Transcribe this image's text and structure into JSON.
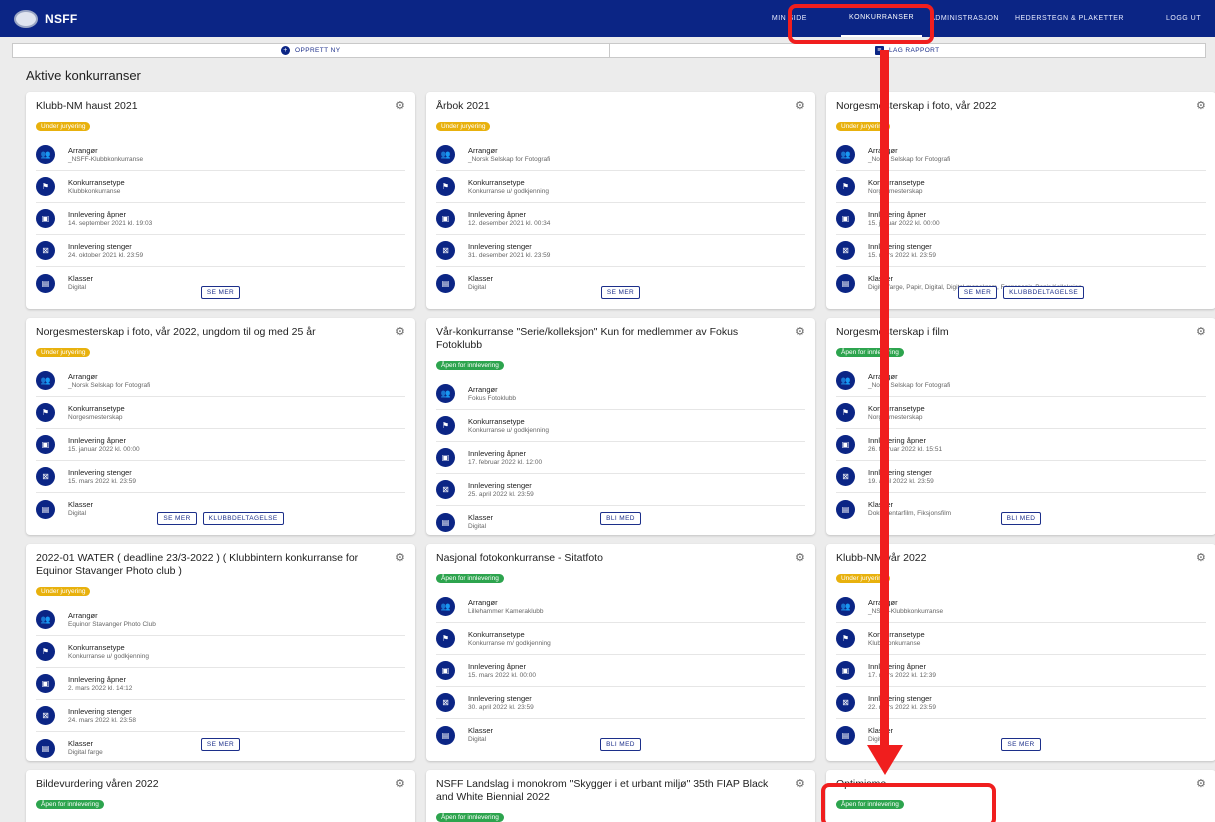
{
  "app": {
    "logo_text": "NSFF"
  },
  "nav": [
    {
      "label": "MIN SIDE"
    },
    {
      "label": "KONKURRANSER"
    },
    {
      "label": "ADMINISTRASJON"
    },
    {
      "label": "HEDERSTEGN & PLAKETTER"
    },
    {
      "label": "LOGG UT"
    }
  ],
  "actions": {
    "create": "OPPRETT NY",
    "report": "LAG RAPPORT"
  },
  "section_title": "Aktive konkurranser",
  "labels": {
    "organizer": "Arrangør",
    "type": "Konkurransetype",
    "opens": "Innlevering åpner",
    "closes": "Innlevering stenger",
    "classes": "Klasser"
  },
  "cards": [
    {
      "title": "Klubb-NM haust 2021",
      "status": "Under juryering",
      "status_color": "#e8b10d",
      "organizer": "_NSFF-Klubbkonkurranse",
      "type": "Klubbkonkurranse",
      "opens": "14. september 2021 kl. 19:03",
      "closes": "24. oktober 2021 kl. 23:59",
      "classes": "Digital",
      "buttons": [
        "SE MER"
      ]
    },
    {
      "title": "Årbok 2021",
      "status": "Under juryering",
      "status_color": "#e8b10d",
      "organizer": "_Norsk Selskap for Fotografi",
      "type": "Konkurranse u/ godkjenning",
      "opens": "12. desember 2021 kl. 00:34",
      "closes": "31. desember 2021 kl. 23:59",
      "classes": "Digital",
      "buttons": [
        "SE MER"
      ]
    },
    {
      "title": "Norgesmesterskap i foto, vår 2022",
      "status": "Under juryering",
      "status_color": "#e8b10d",
      "organizer": "_Norsk Selskap for Fotografi",
      "type": "Norgesmesterskap",
      "opens": "15. januar 2022 kl. 00:00",
      "closes": "15. mars 2022 kl. 23:59",
      "classes": "Digital farge, Papir, Digital, Digital monokrom, Fargepapir, Papir Kolleksjon",
      "buttons": [
        "SE MER",
        "KLUBBDELTAGELSE"
      ]
    },
    {
      "title": "Norgesmesterskap i foto, vår 2022, ungdom til og med 25 år",
      "status": "Under juryering",
      "status_color": "#e8b10d",
      "organizer": "_Norsk Selskap for Fotografi",
      "type": "Norgesmesterskap",
      "opens": "15. januar 2022 kl. 00:00",
      "closes": "15. mars 2022 kl. 23:59",
      "classes": "Digital",
      "buttons": [
        "SE MER",
        "KLUBBDELTAGELSE"
      ]
    },
    {
      "title": "Vår-konkurranse \"Serie/kolleksjon\" Kun for medlemmer av Fokus Fotoklubb",
      "status": "Åpen for innlevering",
      "status_color": "#2da44e",
      "organizer": "Fokus Fotoklubb",
      "type": "Konkurranse u/ godkjenning",
      "opens": "17. februar 2022 kl. 12:00",
      "closes": "25. april 2022 kl. 23:59",
      "classes": "Digital",
      "buttons": [
        "BLI MED"
      ]
    },
    {
      "title": "Norgesmesterskap i film",
      "status": "Åpen for innlevering",
      "status_color": "#2da44e",
      "organizer": "_Norsk Selskap for Fotografi",
      "type": "Norgesmesterskap",
      "opens": "26. februar 2022 kl. 15:51",
      "closes": "19. april 2022 kl. 23:59",
      "classes": "Dokumentarfilm, Fiksjonsfilm",
      "buttons": [
        "BLI MED"
      ]
    },
    {
      "title": "2022-01 WATER ( deadline 23/3-2022 ) ( Klubbintern konkurranse for Equinor Stavanger Photo club )",
      "status": "Under juryering",
      "status_color": "#e8b10d",
      "organizer": "Equinor Stavanger Photo Club",
      "type": "Konkurranse u/ godkjenning",
      "opens": "2. mars 2022 kl. 14:12",
      "closes": "24. mars 2022 kl. 23:58",
      "classes": "Digital farge",
      "buttons": [
        "SE MER"
      ]
    },
    {
      "title": "Nasjonal fotokonkurranse - Sitatfoto",
      "status": "Åpen for innlevering",
      "status_color": "#2da44e",
      "organizer": "Lillehammer Kameraklubb",
      "type": "Konkurranse m/ godkjenning",
      "opens": "15. mars 2022 kl. 00:00",
      "closes": "30. april 2022 kl. 23:59",
      "classes": "Digital",
      "buttons": [
        "BLI MED"
      ]
    },
    {
      "title": "Klubb-NM vår 2022",
      "status": "Under juryering",
      "status_color": "#e8b10d",
      "organizer": "_NSFF-Klubbkonkurranse",
      "type": "Klubbkonkurranse",
      "opens": "17. mars 2022 kl. 12:39",
      "closes": "22. mars 2022 kl. 23:59",
      "classes": "Digital",
      "buttons": [
        "SE MER"
      ]
    },
    {
      "title": "Bildevurdering våren 2022",
      "status": "Åpen for innlevering",
      "status_color": "#2da44e"
    },
    {
      "title": "NSFF Landslag i monokrom \"Skygger i et urbant miljø\" 35th FIAP Black and White Biennial 2022",
      "status": "Åpen for innlevering",
      "status_color": "#2da44e"
    },
    {
      "title": "Optimisme",
      "status": "Åpen for innlevering",
      "status_color": "#2da44e"
    }
  ],
  "annotation_color": "#f01e1e"
}
